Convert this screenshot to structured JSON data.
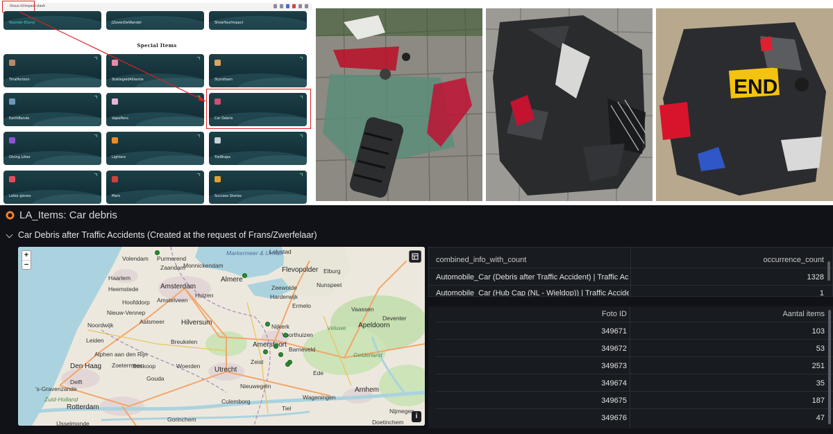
{
  "browser": {
    "url": "litouz.it/impact-dash",
    "section_title": "Special Items",
    "tiles_top": [
      {
        "label": "Noorder-Eiland",
        "cyan": true
      },
      {
        "label": "JZavenDeWandel",
        "cyan": false
      },
      {
        "label": "ShowYourImpact",
        "cyan": false
      }
    ],
    "tiles": [
      {
        "label": "TinaHorizon",
        "icon_color": "#b48a6a"
      },
      {
        "label": "StatiegeldAlliantie",
        "icon_color": "#e98aa8"
      },
      {
        "label": "Styrofoam",
        "icon_color": "#d9a660"
      },
      {
        "label": "EarthBende",
        "icon_color": "#6a9ab8"
      },
      {
        "label": "VapePens",
        "icon_color": "#e4b5d6"
      },
      {
        "label": "Car Debris",
        "icon_color": "#d05070"
      },
      {
        "label": "Diving Litter",
        "icon_color": "#8a54d0"
      },
      {
        "label": "Lighters",
        "icon_color": "#f08a20"
      },
      {
        "label": "TieWraps",
        "icon_color": "#c8d0d8"
      },
      {
        "label": "Latex gloves",
        "icon_color": "#e14d5a"
      },
      {
        "label": "Mars",
        "icon_color": "#d04040"
      },
      {
        "label": "Success Stories",
        "icon_color": "#e0a030"
      }
    ]
  },
  "dashboard": {
    "title": "LA_Items: Car debris",
    "row_title": "Car Debris after Traffic Accidents (Created at the request of Frans/Zwerfelaar)",
    "map": {
      "zoom_in": "+",
      "zoom_out": "−",
      "info": "i",
      "places": [
        {
          "name": "Lelystad",
          "cls": ""
        },
        {
          "name": "Volendam",
          "cls": ""
        },
        {
          "name": "Purmerend",
          "cls": ""
        },
        {
          "name": "Zaandam",
          "cls": ""
        },
        {
          "name": "Monnickendam",
          "cls": ""
        },
        {
          "name": "Markermeer & IJmeer",
          "cls": "water"
        },
        {
          "name": "Flevopolder",
          "cls": "big"
        },
        {
          "name": "Haarlem",
          "cls": ""
        },
        {
          "name": "Amsterdam",
          "cls": "big"
        },
        {
          "name": "Almere",
          "cls": "big"
        },
        {
          "name": "Elburg",
          "cls": ""
        },
        {
          "name": "Zeewolde",
          "cls": ""
        },
        {
          "name": "Nunspeet",
          "cls": ""
        },
        {
          "name": "Heemstede",
          "cls": ""
        },
        {
          "name": "Hoofddorp",
          "cls": ""
        },
        {
          "name": "Amstelveen",
          "cls": ""
        },
        {
          "name": "Huizen",
          "cls": ""
        },
        {
          "name": "Harderwijk",
          "cls": ""
        },
        {
          "name": "Ermelo",
          "cls": ""
        },
        {
          "name": "Vaassen",
          "cls": ""
        },
        {
          "name": "Noordwijk",
          "cls": ""
        },
        {
          "name": "Nieuw-Vennep",
          "cls": ""
        },
        {
          "name": "Aalsmeer",
          "cls": ""
        },
        {
          "name": "Hilversum",
          "cls": "big"
        },
        {
          "name": "Nijkerk",
          "cls": ""
        },
        {
          "name": "Apeldoorn",
          "cls": "big"
        },
        {
          "name": "Deventer",
          "cls": ""
        },
        {
          "name": "Leiden",
          "cls": ""
        },
        {
          "name": "Alphen aan den Rijn",
          "cls": ""
        },
        {
          "name": "Breukelen",
          "cls": ""
        },
        {
          "name": "Voorthuizen",
          "cls": ""
        },
        {
          "name": "Veluwe",
          "cls": "green"
        },
        {
          "name": "Amersfoort",
          "cls": "big"
        },
        {
          "name": "Den Haag",
          "cls": "big"
        },
        {
          "name": "Zoetermeer",
          "cls": ""
        },
        {
          "name": "Boskoop",
          "cls": ""
        },
        {
          "name": "Woerden",
          "cls": ""
        },
        {
          "name": "Utrecht",
          "cls": "big"
        },
        {
          "name": "Barneveld",
          "cls": ""
        },
        {
          "name": "Gelderland",
          "cls": "green"
        },
        {
          "name": "Delft",
          "cls": ""
        },
        {
          "name": "Gouda",
          "cls": ""
        },
        {
          "name": "Zeist",
          "cls": ""
        },
        {
          "name": "Ede",
          "cls": ""
        },
        {
          "name": "Arnhem",
          "cls": "big"
        },
        {
          "name": "'s-Gravenzande",
          "cls": ""
        },
        {
          "name": "Rotterdam",
          "cls": "big"
        },
        {
          "name": "Nieuwegein",
          "cls": ""
        },
        {
          "name": "Wageningen",
          "cls": ""
        },
        {
          "name": "Zuid-Holland",
          "cls": "green"
        },
        {
          "name": "Culemborg",
          "cls": ""
        },
        {
          "name": "Tiel",
          "cls": ""
        },
        {
          "name": "Nijmegen",
          "cls": ""
        },
        {
          "name": "IJsselmonde",
          "cls": ""
        },
        {
          "name": "Gorinchem",
          "cls": ""
        },
        {
          "name": "Doetinchem",
          "cls": ""
        }
      ],
      "markers_count": 9
    },
    "table1": {
      "columns": [
        "combined_info_with_count",
        "occurrence_count"
      ],
      "rows": [
        {
          "info": "Automobile_Car (Debris after Traffic Accident) | Traffic Acc",
          "count": "1328"
        },
        {
          "info": "Automobile_Car (Hub Cap (NL - Wieldop)) | Traffic Accident",
          "count": "1"
        }
      ]
    },
    "table2": {
      "columns": [
        "Foto ID",
        "Aantal items"
      ],
      "rows": [
        {
          "id": "349671",
          "items": "103"
        },
        {
          "id": "349672",
          "items": "53"
        },
        {
          "id": "349673",
          "items": "251"
        },
        {
          "id": "349674",
          "items": "35"
        },
        {
          "id": "349675",
          "items": "187"
        },
        {
          "id": "349676",
          "items": "47"
        }
      ]
    }
  },
  "photos": [
    "debris-photo-1",
    "debris-photo-2",
    "debris-photo-3"
  ]
}
